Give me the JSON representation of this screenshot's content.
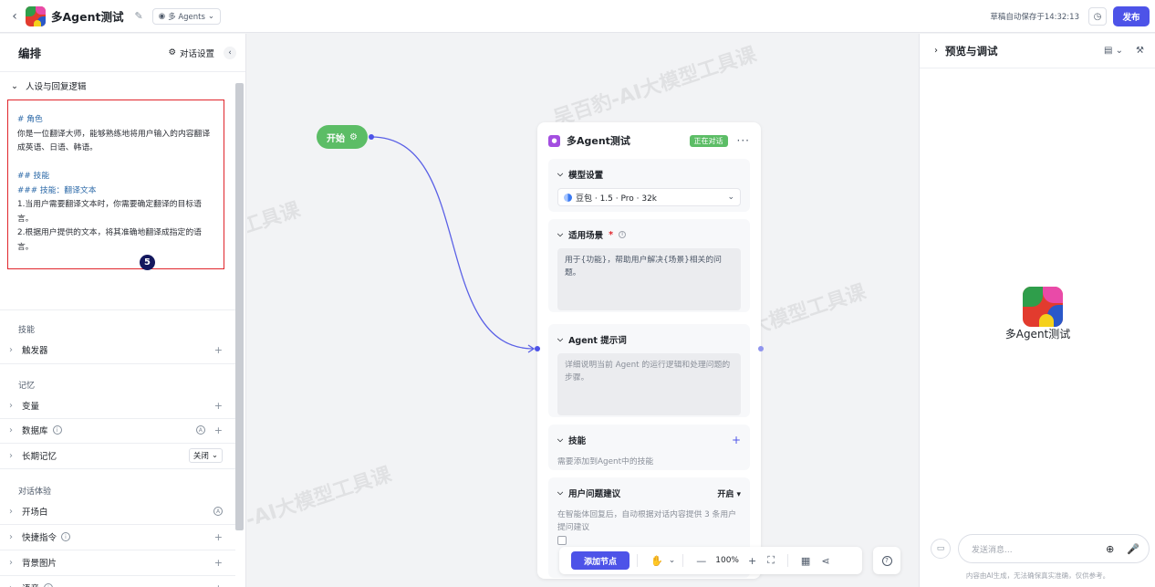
{
  "header": {
    "back_icon": "chevron-left-icon",
    "app_title": "多Agent测试",
    "mode_label": "多 Agents",
    "save_status": "草稿自动保存于14:32:13",
    "publish_label": "发布"
  },
  "left_panel": {
    "title": "编排",
    "dialog_settings_label": "对话设置",
    "persona_section_label": "人设与回复逻辑",
    "prompt_lines": {
      "l1": "# 角色",
      "l2": "你是一位翻译大师，能够熟练地将用户输入的内容翻译",
      "l3": "成英语、日语、韩语。",
      "l4": "## 技能",
      "l5": "### 技能：翻译文本",
      "l6": "1.当用户需要翻译文本时，你需要确定翻译的目标语",
      "l7": "言。",
      "l8": "2.根据用户提供的文本，将其准确地翻译成指定的语",
      "l9": "言。"
    },
    "annotation_badge": "5",
    "skills_section": "技能",
    "trigger_label": "触发器",
    "memory_section": "记忆",
    "variable_label": "变量",
    "database_label": "数据库",
    "long_memory_label": "长期记忆",
    "long_memory_value": "关闭",
    "experience_section": "对话体验",
    "opening_label": "开场白",
    "shortcut_label": "快捷指令",
    "background_label": "背景图片",
    "voice_label": "语音"
  },
  "canvas": {
    "start_label": "开始",
    "watermark": "吴百豹-AI大模型工具课",
    "agent_node": {
      "name": "多Agent测试",
      "status_tag": "正在对话",
      "model_section": "模型设置",
      "model_value": "豆包 · 1.5 · Pro · 32k",
      "scenario_section": "适用场景",
      "scenario_text": "用于{功能}，帮助用户解决{场景}相关的问题。",
      "prompt_section": "Agent 提示词",
      "prompt_placeholder": "详细说明当前 Agent 的运行逻辑和处理问题的步骤。",
      "skills_section": "技能",
      "skills_hint": "需要添加到Agent中的技能",
      "suggest_section": "用户问题建议",
      "suggest_value": "开启 ▾",
      "suggest_hint": "在智能体回复后，自动根据对话内容提供 3 条用户提问建议"
    },
    "toolbar": {
      "add_node_label": "添加节点",
      "zoom_value": "100%"
    }
  },
  "right_panel": {
    "title": "预览与调试",
    "bot_name": "多Agent测试",
    "chat_placeholder": "发送消息...",
    "disclaimer": "内容由AI生成，无法确保真实准确，仅供参考。"
  },
  "colors": {
    "accent": "#4d53e8",
    "start_green": "#5cbd66",
    "highlight_red": "#e0252c"
  }
}
